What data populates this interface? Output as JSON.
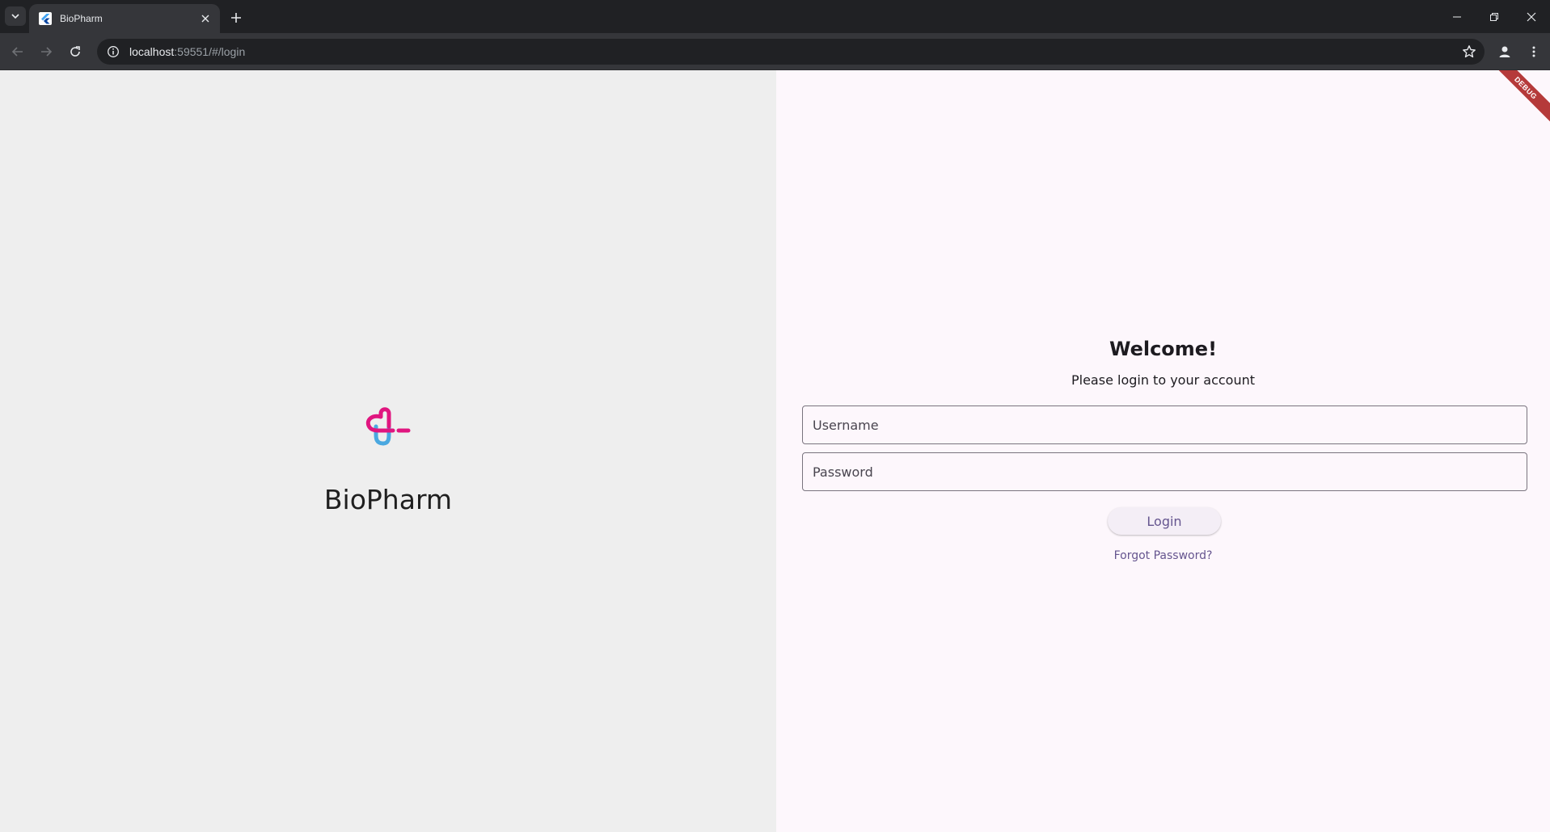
{
  "browser": {
    "tab_title": "BioPharm",
    "url_host": "localhost",
    "url_path": ":59551/#/login"
  },
  "icons": {
    "tab_search": "chevron-down-icon",
    "favicon": "flutter-icon",
    "tab_close": "close-icon",
    "new_tab": "plus-icon",
    "minimize": "minimize-icon",
    "restore": "restore-icon",
    "close_window": "close-icon",
    "back": "arrow-left-icon",
    "forward": "arrow-right-icon",
    "reload": "reload-icon",
    "site_info": "info-icon",
    "bookmark": "star-icon",
    "profile": "person-icon",
    "menu": "kebab-menu-icon"
  },
  "left": {
    "brand_name": "BioPharm"
  },
  "login": {
    "heading": "Welcome!",
    "subtitle": "Please login to your account",
    "username_placeholder": "Username",
    "password_placeholder": "Password",
    "login_label": "Login",
    "forgot_label": "Forgot Password?"
  },
  "debug_banner": "DEBUG",
  "colors": {
    "left_bg": "#eeeeee",
    "right_bg": "#fdf7fc",
    "accent": "#65558f",
    "logo_pink": "#e0157f",
    "logo_blue": "#4aa8e0"
  }
}
